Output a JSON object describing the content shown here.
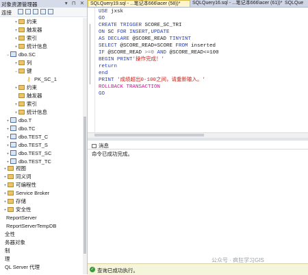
{
  "object_explorer": {
    "title": "对象资源管理器",
    "pin": "▾ ⊓ ✕",
    "connect": "连接",
    "tree": [
      {
        "label": "约束",
        "icon": "folder",
        "exp": "+"
      },
      {
        "label": "触发器",
        "icon": "folder",
        "exp": "+"
      },
      {
        "label": "索引",
        "icon": "folder",
        "exp": "+"
      },
      {
        "label": "统计信息",
        "icon": "folder",
        "exp": "+"
      },
      {
        "label": "dbo.SC",
        "icon": "table",
        "exp": "−"
      },
      {
        "label": "列",
        "icon": "folder",
        "exp": "+"
      },
      {
        "label": "键",
        "icon": "folder",
        "exp": "−"
      },
      {
        "label": "PK_SC_1",
        "icon": "key",
        "exp": ""
      },
      {
        "label": "约束",
        "icon": "folder",
        "exp": "+"
      },
      {
        "label": "触发器",
        "icon": "folder",
        "exp": ""
      },
      {
        "label": "索引",
        "icon": "folder",
        "exp": "+"
      },
      {
        "label": "统计信息",
        "icon": "folder",
        "exp": "+"
      },
      {
        "label": "dbo.T",
        "icon": "table",
        "exp": "+"
      },
      {
        "label": "dbo.TC",
        "icon": "table",
        "exp": "+"
      },
      {
        "label": "dbo.TEST_C",
        "icon": "table",
        "exp": "+"
      },
      {
        "label": "dbo.TEST_S",
        "icon": "table",
        "exp": "+"
      },
      {
        "label": "dbo.TEST_SC",
        "icon": "table",
        "exp": "+"
      },
      {
        "label": "dbo.TEST_TC",
        "icon": "table",
        "exp": "+"
      },
      {
        "label": "视图",
        "icon": "folder",
        "exp": "+"
      },
      {
        "label": "同义词",
        "icon": "folder",
        "exp": "+"
      },
      {
        "label": "可编程性",
        "icon": "folder",
        "exp": "+"
      },
      {
        "label": "Service Broker",
        "icon": "folder",
        "exp": "+"
      },
      {
        "label": "存储",
        "icon": "folder",
        "exp": "+"
      },
      {
        "label": "安全性",
        "icon": "folder",
        "exp": "+"
      },
      {
        "label": "ReportServer",
        "icon": "none",
        "exp": ""
      },
      {
        "label": "ReportServerTempDB",
        "icon": "none",
        "exp": ""
      },
      {
        "label": "全性",
        "icon": "none",
        "exp": ""
      },
      {
        "label": "务器对象",
        "icon": "none",
        "exp": ""
      },
      {
        "label": "制",
        "icon": "none",
        "exp": ""
      },
      {
        "label": "理",
        "icon": "none",
        "exp": ""
      },
      {
        "label": "QL Server 代理",
        "icon": "none",
        "exp": ""
      }
    ]
  },
  "tabs": [
    {
      "label": "SQLQuery19.sql - ...笔记本666\\acer (58))*",
      "active": true
    },
    {
      "label": "SQLQuery16.sql - ...笔记本666\\acer (61))*",
      "active": false
    },
    {
      "label": "SQLQue",
      "active": false
    }
  ],
  "code": {
    "l1_kw": "USE",
    "l1_rest": " jxsk",
    "l2": "GO",
    "l3_kw": "CREATE TRIGGER",
    "l3_rest": " SCORE_SC_TRI",
    "l4_kw": "ON",
    "l4_mid": " SC ",
    "l4_kw2": "FOR INSERT,UPDATE",
    "l5_kw": "AS DECLARE",
    "l5_mid": " @SCORE_READ ",
    "l5_kw2": "TINYINT",
    "l6_kw": "SELECT",
    "l6_mid": " @SCORE_READ=SCORE ",
    "l6_kw2": "FROM",
    "l6_rest": " inserted",
    "l7_kw": "IF",
    "l7_a": " @SCORE_READ ",
    "l7_b": ">=0 ",
    "l7_c": "AND",
    "l7_d": " @SCORE_READ<=100",
    "l8_kw": "BEGIN PRINT",
    "l8_str": "'操作完成！'",
    "l9": "return",
    "l10": "end",
    "l11_kw": "PRINT",
    "l11_str": "'成绩超出0-100之间，请重新输入。'",
    "l12": "ROLLBACK TRANSACTION",
    "l13": "GO"
  },
  "results": {
    "tab_label": "消息",
    "message": "命令已成功完成。"
  },
  "status": {
    "message": "查询已成功执行。"
  },
  "watermark": "公众号 · 疯狂学习GIS"
}
